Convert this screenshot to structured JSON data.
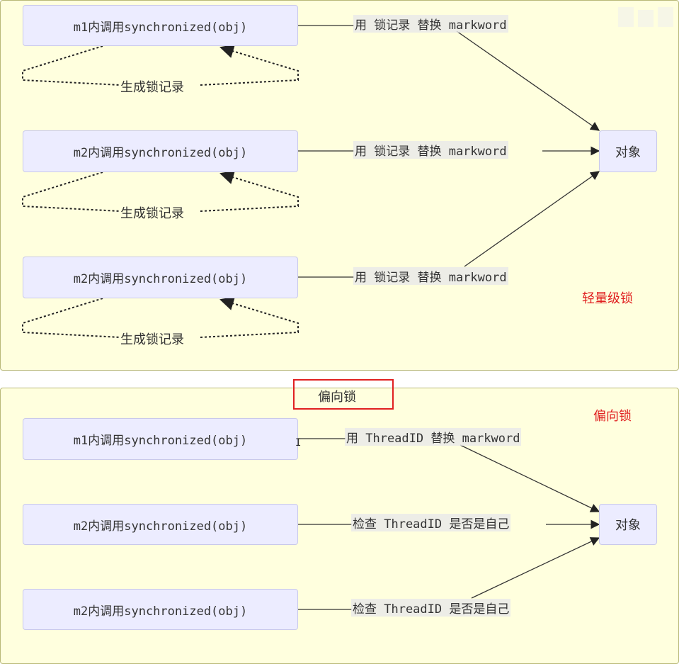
{
  "lightweight": {
    "label": "轻量级锁",
    "callers": [
      {
        "name": "m1内调用synchronized(obj)",
        "edge": "用 锁记录 替换 markword",
        "loop": "生成锁记录"
      },
      {
        "name": "m2内调用synchronized(obj)",
        "edge": "用 锁记录 替换 markword",
        "loop": "生成锁记录"
      },
      {
        "name": "m2内调用synchronized(obj)",
        "edge": "用 锁记录 替换 markword",
        "loop": "生成锁记录"
      }
    ],
    "target": "对象"
  },
  "biased": {
    "section_title": "偏向锁",
    "label": "偏向锁",
    "callers": [
      {
        "name": "m1内调用synchronized(obj)",
        "edge": "用 ThreadID 替换 markword"
      },
      {
        "name": "m2内调用synchronized(obj)",
        "edge": "检查 ThreadID 是否是自己"
      },
      {
        "name": "m2内调用synchronized(obj)",
        "edge": "检查 ThreadID 是否是自己"
      }
    ],
    "target": "对象"
  },
  "colors": {
    "panel": "#ffffde",
    "node": "#ececff",
    "highlight": "#e02020"
  },
  "cursor_glyph": "I"
}
